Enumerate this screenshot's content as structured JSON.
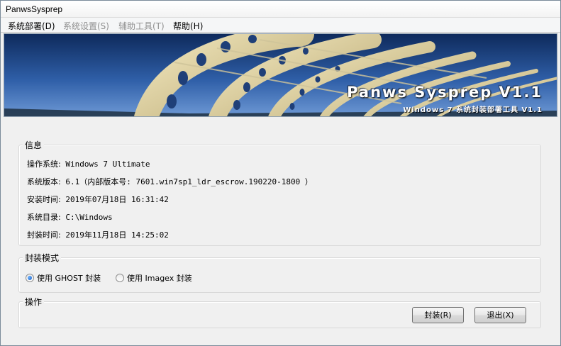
{
  "window": {
    "title": "PanwsSysprep"
  },
  "menu": [
    {
      "label": "系统部署(D)",
      "enabled": true
    },
    {
      "label": "系统设置(S)",
      "enabled": false
    },
    {
      "label": "辅助工具(T)",
      "enabled": false
    },
    {
      "label": "帮助(H)",
      "enabled": true
    }
  ],
  "banner": {
    "title": "Panws Sysprep V1.1",
    "subtitle": "Windows 7 系统封装部署工具 V1.1"
  },
  "info": {
    "legend": "信息",
    "rows": [
      {
        "label": "操作系统:",
        "value": "Windows 7 Ultimate"
      },
      {
        "label": "系统版本:",
        "value": "6.1（内部版本号: 7601.win7sp1_ldr_escrow.190220-1800 ）"
      },
      {
        "label": "安装时间:",
        "value": "2019年07月18日 16:31:42"
      },
      {
        "label": "系统目录:",
        "value": "C:\\Windows"
      },
      {
        "label": "封装时间:",
        "value": "2019年11月18日 14:25:02"
      }
    ]
  },
  "mode": {
    "legend": "封装模式",
    "options": [
      {
        "label": "使用 GHOST 封装",
        "selected": true
      },
      {
        "label": "使用 Imagex 封装",
        "selected": false
      }
    ]
  },
  "ops": {
    "legend": "操作",
    "seal_label": "封装(R)",
    "exit_label": "退出(X)"
  },
  "colors": {
    "sky_top": "#0e2a5c",
    "sky_bottom": "#5f8fd0",
    "structure": "#d9cfa0"
  }
}
